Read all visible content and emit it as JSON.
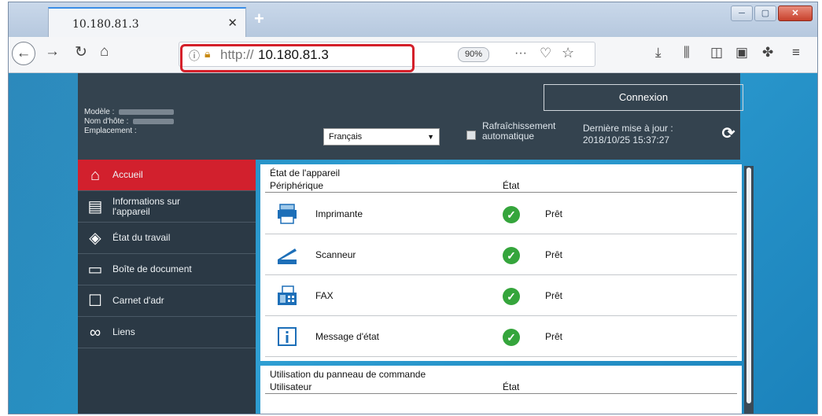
{
  "browser": {
    "tab_title": "10.180.81.3",
    "tab_close": "✕",
    "new_tab": "+",
    "window_controls": [
      "─",
      "▢",
      "✕"
    ],
    "url_protocol": "http://",
    "url_host": "10.180.81.3",
    "zoom_level": "90%",
    "more_actions": "···"
  },
  "header": {
    "model_label": "Modèle :",
    "hostname_label": "Nom d'hôte :",
    "location_label": "Emplacement :",
    "language_selected": "Français",
    "auto_refresh_line1": "Rafraîchissement",
    "auto_refresh_line2": "automatique",
    "last_update_label": "Dernière mise à jour :",
    "last_update_value": "2018/10/25 15:37:27",
    "login_button": "Connexion"
  },
  "sidebar": {
    "items": [
      {
        "label": "Accueil",
        "icon": "home-icon",
        "active": true
      },
      {
        "label": "Informations sur l'appareil",
        "line1": "Informations sur",
        "line2": "l'appareil",
        "icon": "device-info-icon",
        "active": false
      },
      {
        "label": "État du travail",
        "icon": "job-status-icon",
        "active": false
      },
      {
        "label": "Boîte de document",
        "icon": "document-box-icon",
        "active": false
      },
      {
        "label": "Carnet d'adr",
        "icon": "address-book-icon",
        "active": false
      },
      {
        "label": "Liens",
        "icon": "links-icon",
        "active": false
      }
    ]
  },
  "device_status": {
    "title": "État de l'appareil",
    "col_device": "Périphérique",
    "col_status": "État",
    "rows": [
      {
        "name": "Imprimante",
        "status": "Prêt",
        "icon": "printer-icon"
      },
      {
        "name": "Scanneur",
        "status": "Prêt",
        "icon": "scanner-icon"
      },
      {
        "name": "FAX",
        "status": "Prêt",
        "icon": "fax-icon"
      },
      {
        "name": "Message d'état",
        "status": "Prêt",
        "icon": "info-icon"
      }
    ]
  },
  "panel_usage": {
    "title": "Utilisation du panneau de commande",
    "col_user": "Utilisateur",
    "col_status": "État"
  },
  "colors": {
    "accent_red": "#d2202d",
    "header_dark": "#34434f",
    "sidebar_dark": "#2b3945",
    "status_green": "#35a53c",
    "page_blue": "#2f9fd3",
    "url_highlight": "#d4202a"
  }
}
